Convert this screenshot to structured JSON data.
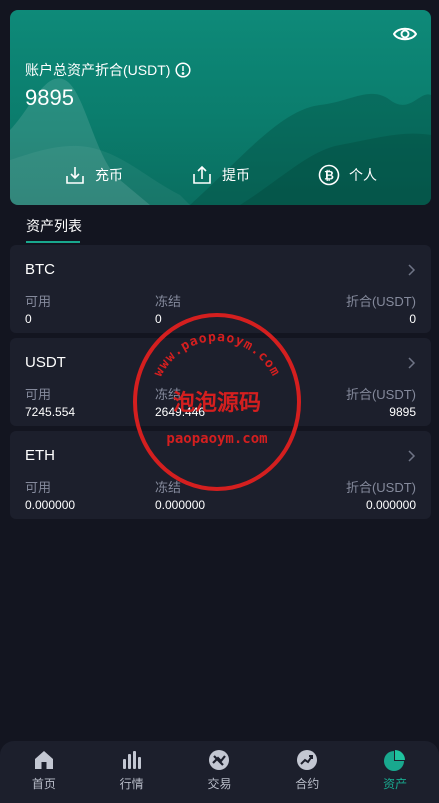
{
  "hero": {
    "title": "账户总资产折合(USDT)",
    "total": "9895",
    "actions": [
      {
        "label": "充币",
        "icon": "deposit-icon"
      },
      {
        "label": "提币",
        "icon": "withdraw-icon"
      },
      {
        "label": "个人",
        "icon": "bitcoin-icon"
      }
    ]
  },
  "section": {
    "title": "资产列表"
  },
  "assets": [
    {
      "name": "BTC",
      "available_label": "可用",
      "frozen_label": "冻结",
      "equiv_label": "折合(USDT)",
      "available": "0",
      "frozen": "0",
      "equiv": "0"
    },
    {
      "name": "USDT",
      "available_label": "可用",
      "frozen_label": "冻结",
      "equiv_label": "折合(USDT)",
      "available": "7245.554",
      "frozen": "2649.446",
      "equiv": "9895"
    },
    {
      "name": "ETH",
      "available_label": "可用",
      "frozen_label": "冻结",
      "equiv_label": "折合(USDT)",
      "available": "0.000000",
      "frozen": "0.000000",
      "equiv": "0.000000"
    }
  ],
  "watermark": {
    "top_text": "www.paopaoym.com",
    "center_text": "泡泡源码",
    "bottom_text": "paopaoym.com"
  },
  "tabs": [
    {
      "label": "首页",
      "icon": "home-icon"
    },
    {
      "label": "行情",
      "icon": "market-icon"
    },
    {
      "label": "交易",
      "icon": "trade-icon"
    },
    {
      "label": "合约",
      "icon": "contract-icon"
    },
    {
      "label": "资产",
      "icon": "assets-icon",
      "active": true
    }
  ],
  "colors": {
    "accent": "#19a88e",
    "hero_bg": "#0e8a79",
    "page_bg": "#131520",
    "card_bg": "#1c1f2c",
    "muted_text": "#858a9c",
    "stamp_red": "#d41f1f"
  }
}
